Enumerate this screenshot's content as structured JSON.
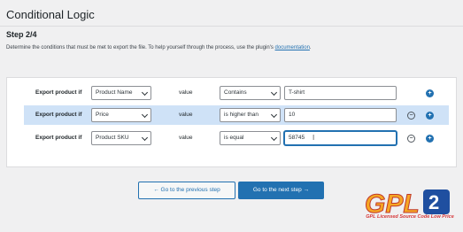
{
  "page": {
    "title": "Conditional Logic",
    "step": "Step 2/4",
    "description_prefix": "Determine the conditions that must be met to export the file. To help yourself through the process, use the plugin's ",
    "description_link": "documentation",
    "description_suffix": "."
  },
  "conditions": [
    {
      "label": "Export product if",
      "field": "Product Name",
      "value_label": "value",
      "operator": "Contains",
      "value": "T-shirt",
      "removable": false,
      "highlighted": false
    },
    {
      "label": "Export product if",
      "field": "Price",
      "value_label": "value",
      "operator": "is higher than",
      "value": "10",
      "removable": true,
      "highlighted": true
    },
    {
      "label": "Export product if",
      "field": "Product SKU",
      "value_label": "value",
      "operator": "is equal",
      "value": "58745",
      "removable": true,
      "highlighted": false
    }
  ],
  "icons": {
    "add": "+",
    "remove": "−",
    "cursor": "I"
  },
  "buttons": {
    "prev": "← Go to the previous step",
    "next": "Go to the next step →"
  },
  "watermark": {
    "logo_text": "GPL",
    "tagline": "GPL Licensed Source Code Low Price"
  },
  "colors": {
    "accent": "#2271b1",
    "highlight_row": "#cfe2f7",
    "watermark_orange": "#f5a623",
    "watermark_blue": "#1f4fa0"
  }
}
